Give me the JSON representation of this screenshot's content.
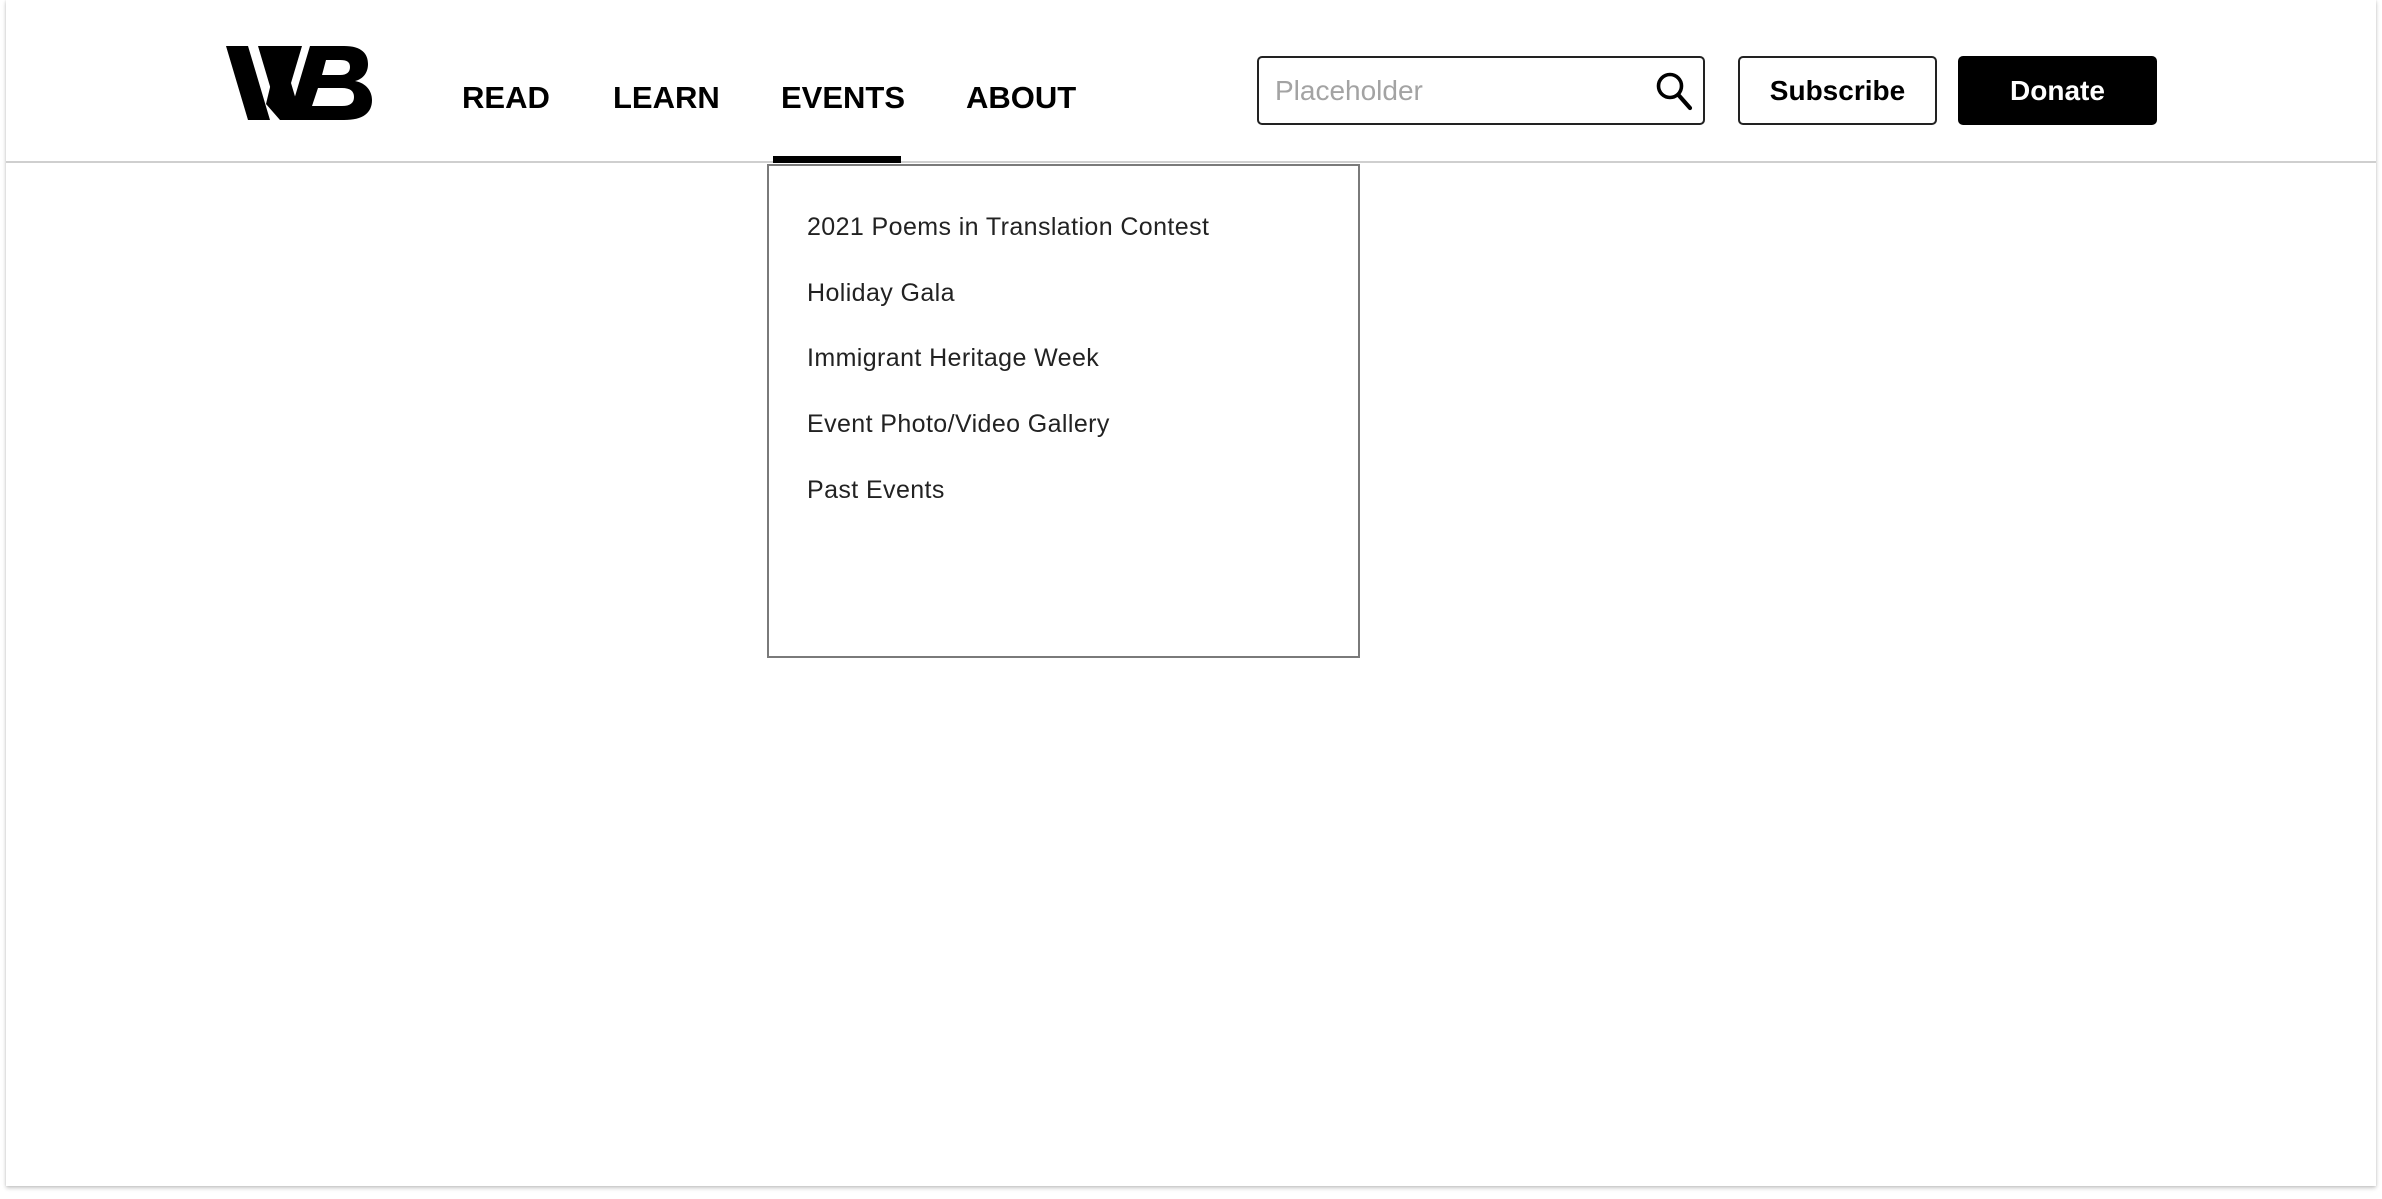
{
  "header": {
    "logo_text": "WB",
    "nav": [
      {
        "label": "READ"
      },
      {
        "label": "LEARN"
      },
      {
        "label": "EVENTS",
        "active": true
      },
      {
        "label": "ABOUT"
      }
    ],
    "search": {
      "placeholder": "Placeholder",
      "value": "",
      "icon": "search-icon"
    },
    "subscribe_label": "Subscribe",
    "donate_label": "Donate"
  },
  "events_menu": {
    "items": [
      {
        "label": "2021 Poems in Translation Contest"
      },
      {
        "label": "Holiday Gala"
      },
      {
        "label": "Immigrant Heritage Week"
      },
      {
        "label": "Event Photo/Video Gallery"
      },
      {
        "label": "Past Events"
      }
    ]
  },
  "colors": {
    "text": "#000000",
    "accent": "#000000",
    "placeholder": "#a3a3a3",
    "border": "#222222"
  }
}
